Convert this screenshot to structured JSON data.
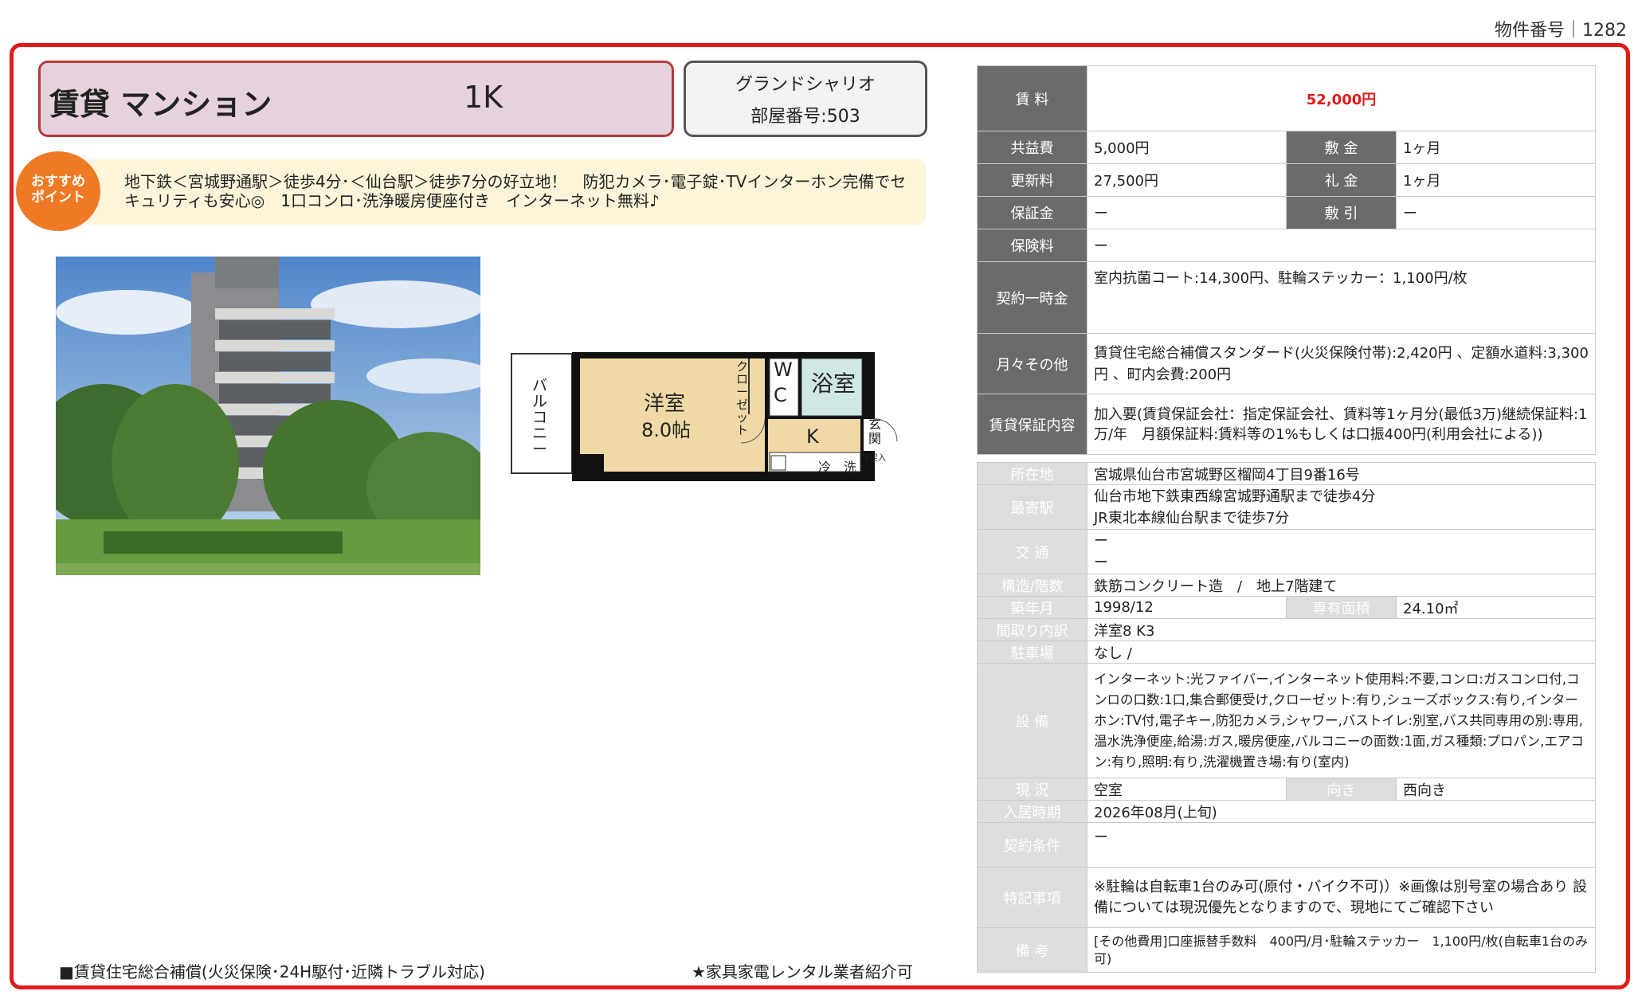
{
  "header": {
    "property_number": "物件番号｜1282",
    "type": "賃貸 マンション",
    "layout": "1K",
    "building_name": "グランドシャリオ",
    "room_number": "部屋番号:503"
  },
  "promo": {
    "badge": "おすすめポイント",
    "badge_line1": "おすすめ",
    "badge_line2": "ポイント",
    "text": "地下鉄＜宮城野通駅＞徒歩4分･＜仙台駅＞徒歩7分の好立地！　防犯カメラ･電子錠･TVインターホン完備でセキュリティも安心◎　1口コンロ･洗浄暖房便座付き　インターネット無料♪"
  },
  "floorplan": {
    "room": "洋室",
    "room_size": "8.0帖",
    "closet": "クローゼット",
    "wc_w": "W",
    "wc_c": "C",
    "bath": "浴室",
    "kitchen": "K",
    "entrance": "玄関",
    "shoe": "下足入",
    "fridge": "冷",
    "washer": "洗",
    "balcony": "バルコニー"
  },
  "footer": {
    "left": "■賃貸住宅総合補償(火災保険･24H駆付･近隣トラブル対応)",
    "right": "★家具家電レンタル業者紹介可"
  },
  "fees": {
    "rent_label": "賃 料",
    "rent": "52,000円",
    "common_label": "共益費",
    "common": "5,000円",
    "deposit_label": "敷 金",
    "deposit": "1ヶ月",
    "renewal_label": "更新料",
    "renewal": "27,500円",
    "key_label": "礼 金",
    "key": "1ヶ月",
    "guarantee_label": "保証金",
    "guarantee": "ー",
    "shikibiki_label": "敷 引",
    "shikibiki": "ー",
    "insurance_label": "保険料",
    "insurance": "ー",
    "onetime_label": "契約一時金",
    "onetime": "室内抗菌コート:14,300円、駐輪ステッカー：1,100円/枚",
    "monthly_label": "月々その他",
    "monthly": "賃貸住宅総合補償スタンダード(火災保険付帯):2,420円 、定額水道料:3,300円 、町内会費:200円",
    "guarantor_label": "賃貸保証内容",
    "guarantor": "加入要(賃貸保証会社：指定保証会社、賃料等1ヶ月分(最低3万)継続保証料:1万/年　月額保証料:賃料等の1%もしくは口振400円(利用会社による))"
  },
  "details": {
    "address_label": "所在地",
    "address": "宮城県仙台市宮城野区榴岡4丁目9番16号",
    "station_label": "最寄駅",
    "station1": "仙台市地下鉄東西線宮城野通駅まで徒歩4分",
    "station2": "JR東北本線仙台駅まで徒歩7分",
    "transport_label": "交 通",
    "transport1": "ー",
    "transport2": "ー",
    "structure_label": "構造/階数",
    "structure": "鉄筋コンクリート造　/　地上7階建て",
    "built_label": "築年月",
    "built": "1998/12",
    "area_label": "専有面積",
    "area": "24.10㎡",
    "rooms_label": "間取り内訳",
    "rooms": "洋室8 K3",
    "parking_label": "駐車場",
    "parking": "なし /",
    "equipment_label": "設 備",
    "equipment": "インターネット:光ファイバー,インターネット使用料:不要,コンロ:ガスコンロ付,コンロの口数:1口,集合郵便受け,クローゼット:有り,シューズボックス:有り,インターホン:TV付,電子キー,防犯カメラ,シャワー,バストイレ:別室,バス共同専用の別:専用,温水洗浄便座,給湯:ガス,暖房便座,バルコニーの面数:1面,ガス種類:プロパン,エアコン:有り,照明:有り,洗濯機置き場:有り(室内)",
    "status_label": "現 況",
    "status": "空室",
    "direction_label": "向き",
    "direction": "西向き",
    "movein_label": "入居時期",
    "movein": "2026年08月(上旬)",
    "conditions_label": "契約条件",
    "conditions": "ー",
    "notes_label": "特記事項",
    "notes": "※駐輪は自転車1台のみ可(原付・バイク不可)）※画像は別号室の場合あり 設備については現況優先となりますので、現地にてご確認下さい",
    "remarks_label": "備 考",
    "remarks": "[その他費用]口座振替手数料　400円/月･駐輪ステッカー　1,100円/枚(自転車1台のみ可)"
  },
  "colors": {
    "frame": "#e01b1b",
    "price": "#e01b1b",
    "type_bg": "#e6d2de",
    "badge": "#ee7a26",
    "label_dark": "#6b6b6b",
    "label_light": "#dddddd",
    "plan_room": "#f0d9a6",
    "plan_bath": "#cfe8e6"
  }
}
